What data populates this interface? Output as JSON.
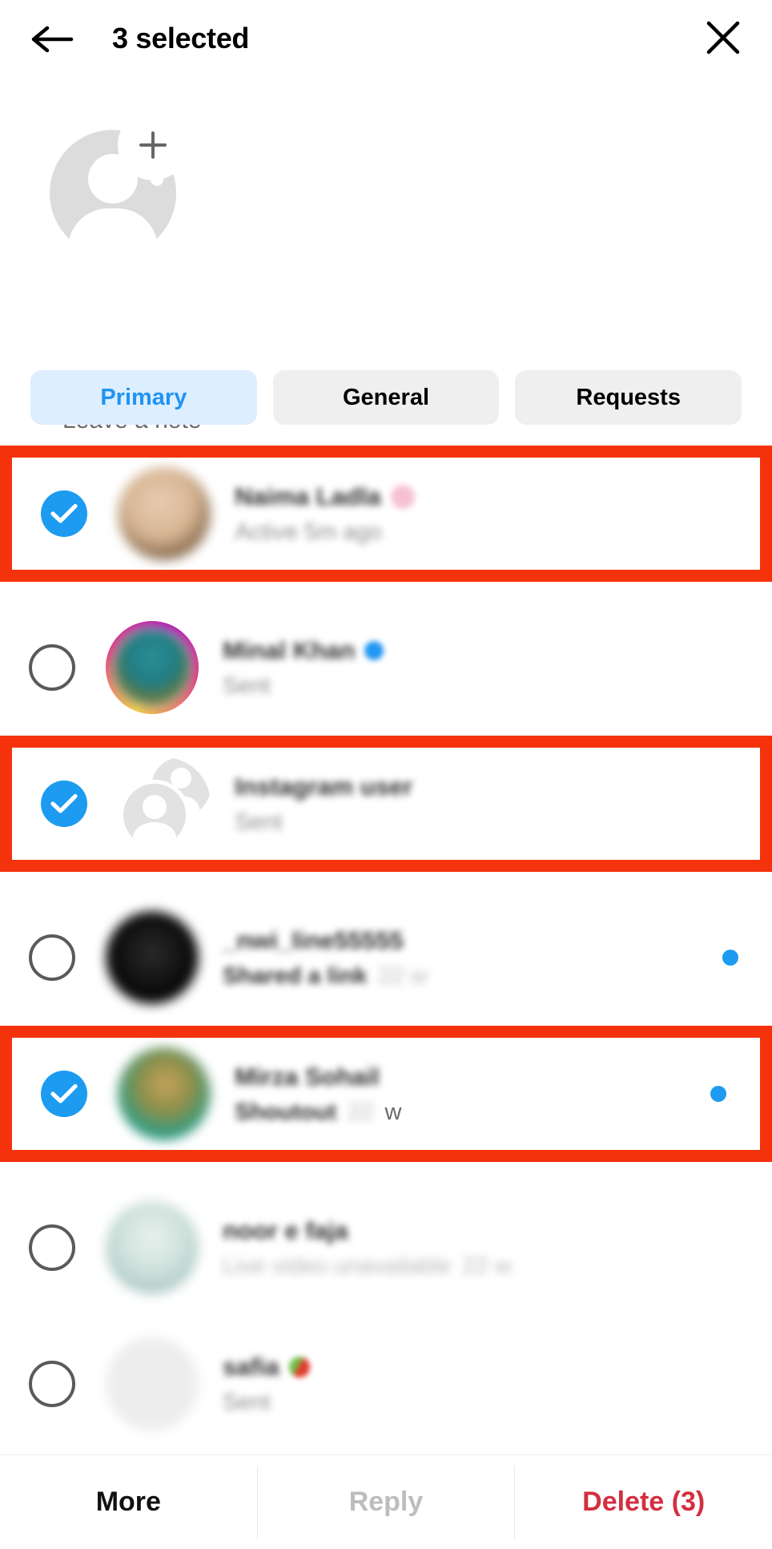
{
  "header": {
    "back_icon": "arrow-left-icon",
    "title": "3 selected",
    "close_icon": "close-icon"
  },
  "note": {
    "label": "Leave a note",
    "add_icon": "plus-icon",
    "avatar_icon": "default-person-avatar"
  },
  "tabs": [
    {
      "label": "Primary",
      "active": true
    },
    {
      "label": "General",
      "active": false
    },
    {
      "label": "Requests",
      "active": false
    }
  ],
  "colors": {
    "accent_blue": "#1d9bf0",
    "tab_active_text": "#2094f3",
    "tab_active_bg": "#ddeeff",
    "tab_bg": "#efefef",
    "highlight_red": "#f4330d",
    "delete_red": "#d32f3f",
    "muted_text": "#8e8e8e"
  },
  "conversations": [
    {
      "name": "Naima Ladla",
      "subtitle": "Active 5m ago",
      "selected": true,
      "highlighted": true,
      "unread": false,
      "emoji": "pink-emoji",
      "verified": false,
      "story_ring": false,
      "timestamp": ""
    },
    {
      "name": "Minal Khan",
      "subtitle": "Sent",
      "selected": false,
      "highlighted": false,
      "unread": false,
      "emoji": "",
      "verified": true,
      "story_ring": true,
      "timestamp": ""
    },
    {
      "name": "Instagram user",
      "subtitle": "Sent",
      "selected": true,
      "highlighted": true,
      "unread": false,
      "emoji": "",
      "verified": false,
      "story_ring": false,
      "timestamp": ""
    },
    {
      "name": "_nwi_line55555",
      "subtitle": "Shared a link",
      "selected": false,
      "highlighted": false,
      "unread": true,
      "emoji": "",
      "verified": false,
      "story_ring": false,
      "timestamp": "22 w"
    },
    {
      "name": "Mirza Sohail",
      "subtitle": "Shoutout",
      "selected": true,
      "highlighted": true,
      "unread": true,
      "emoji": "",
      "verified": false,
      "story_ring": false,
      "timestamp": "22",
      "timestamp_unit": "w"
    },
    {
      "name": "noor e faja",
      "subtitle": "Live video unavailable",
      "selected": false,
      "highlighted": false,
      "unread": false,
      "emoji": "",
      "verified": false,
      "story_ring": false,
      "timestamp": "22 w"
    },
    {
      "name": "safia",
      "subtitle": "Sent",
      "selected": false,
      "highlighted": false,
      "unread": false,
      "emoji": "green-red-emoji",
      "verified": false,
      "story_ring": false,
      "timestamp": ""
    }
  ],
  "bottom_bar": {
    "more": "More",
    "reply": "Reply",
    "delete": "Delete (3)"
  }
}
